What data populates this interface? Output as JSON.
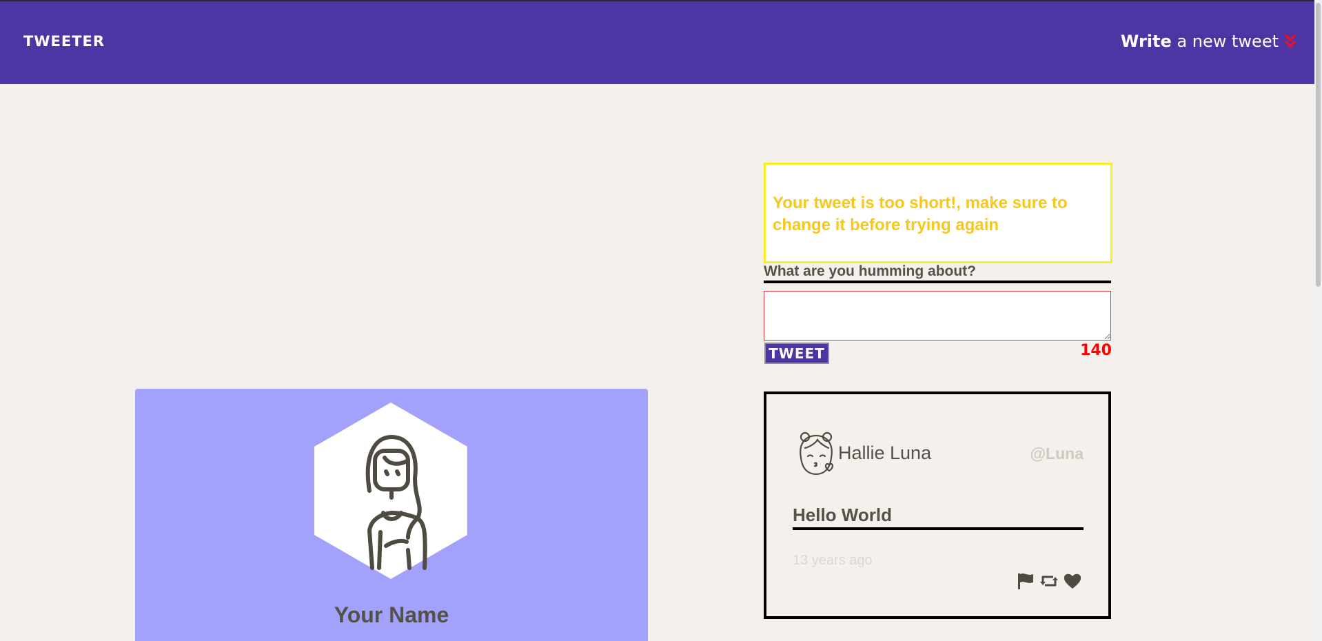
{
  "nav": {
    "brand": "TWEETER",
    "compose_strong": "Write",
    "compose_rest": "a new tweet"
  },
  "profile": {
    "name": "Your Name"
  },
  "composer": {
    "error": "Your tweet is too short!, make sure to change it before trying again",
    "label": "What are you humming about?",
    "input_value": "",
    "submit_label": "TWEET",
    "counter": "140"
  },
  "tweets": [
    {
      "name": "Hallie Luna",
      "handle": "@Luna",
      "content": "Hello World",
      "time": "13 years ago",
      "actions": [
        "flag-icon",
        "retweet-icon",
        "heart-icon"
      ]
    }
  ],
  "colors": {
    "navbar": "#4d36a4",
    "background": "#f4f1ec",
    "profile_card": "#a2a2fc",
    "error_border": "#f7f021",
    "error_text": "#f7c81b",
    "counter": "#ff0000"
  }
}
